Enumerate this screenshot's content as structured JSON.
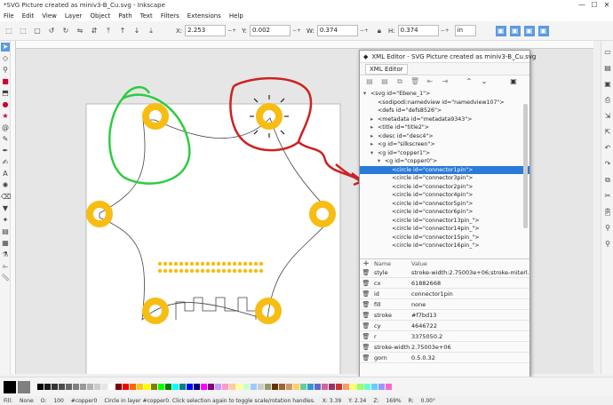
{
  "window": {
    "title": "*SVG Picture created as miniv3-B_Cu.svg - Inkscape",
    "controls": [
      "—",
      "☐",
      "✕"
    ]
  },
  "menu": [
    "File",
    "Edit",
    "View",
    "Layer",
    "Object",
    "Path",
    "Text",
    "Filters",
    "Extensions",
    "Help"
  ],
  "toolbar": {
    "x_label": "X:",
    "x_value": "2.253",
    "y_label": "Y:",
    "y_value": "0.002",
    "w_label": "W:",
    "w_value": "0.374",
    "h_label": "H:",
    "h_value": "0.374",
    "unit": "in"
  },
  "xml_editor": {
    "title": "XML Editor - SVG Picture created as miniv3-B_Cu.svg",
    "tab": "XML Editor",
    "nodes": [
      {
        "indent": 0,
        "arrow": "▾",
        "text": "<svg id=\"Ebene_1\">"
      },
      {
        "indent": 1,
        "arrow": "",
        "text": "<sodipodi:namedview id=\"namedview107\">"
      },
      {
        "indent": 1,
        "arrow": "",
        "text": "<defs id=\"defs8526\">"
      },
      {
        "indent": 1,
        "arrow": "▸",
        "text": "<metadata id=\"metadata9343\">"
      },
      {
        "indent": 1,
        "arrow": "▸",
        "text": "<title id=\"title2\">"
      },
      {
        "indent": 1,
        "arrow": "▸",
        "text": "<desc id=\"desc4\">"
      },
      {
        "indent": 1,
        "arrow": "▸",
        "text": "<g id=\"silkscreen\">"
      },
      {
        "indent": 1,
        "arrow": "▾",
        "text": "<g id=\"copper1\">"
      },
      {
        "indent": 2,
        "arrow": "▾",
        "text": "<g id=\"copper0\">"
      },
      {
        "indent": 3,
        "arrow": "",
        "text": "<circle id=\"connector1pin\">",
        "selected": true
      },
      {
        "indent": 3,
        "arrow": "",
        "text": "<circle id=\"connector3pin\">"
      },
      {
        "indent": 3,
        "arrow": "",
        "text": "<circle id=\"connector2pin\">"
      },
      {
        "indent": 3,
        "arrow": "",
        "text": "<circle id=\"connector4pin\">"
      },
      {
        "indent": 3,
        "arrow": "",
        "text": "<circle id=\"connector5pin\">"
      },
      {
        "indent": 3,
        "arrow": "",
        "text": "<circle id=\"connector6pin\">"
      },
      {
        "indent": 3,
        "arrow": "",
        "text": "<circle id=\"connector13pin_\">"
      },
      {
        "indent": 3,
        "arrow": "",
        "text": "<circle id=\"connector14pin_\">"
      },
      {
        "indent": 3,
        "arrow": "",
        "text": "<circle id=\"connector15pin_\">"
      },
      {
        "indent": 3,
        "arrow": "",
        "text": "<circle id=\"connector16pin_\">"
      }
    ],
    "attr_header": {
      "add": "+",
      "name": "Name",
      "value": "Value"
    },
    "attributes": [
      {
        "name": "style",
        "value": "stroke-width:2.75003e+06;stroke-miterl..."
      },
      {
        "name": "cx",
        "value": "61882668"
      },
      {
        "name": "id",
        "value": "connector1pin"
      },
      {
        "name": "fill",
        "value": "none"
      },
      {
        "name": "stroke",
        "value": "#f7bd13"
      },
      {
        "name": "cy",
        "value": "4646722"
      },
      {
        "name": "r",
        "value": "3375050.2"
      },
      {
        "name": "stroke-width",
        "value": "2.75003e+06"
      },
      {
        "name": "gorn",
        "value": "0.5.0.32"
      }
    ]
  },
  "status": {
    "fill_label": "Fill:",
    "fill_value": "None",
    "stroke_label": "Stroke:",
    "opacity_label": "O:",
    "opacity_value": "100",
    "layer": "#copper0",
    "message": "Circle in layer #copper0. Click selection again to toggle scale/rotation handles.",
    "x_coord": "X: 3.39",
    "y_coord": "Y: 2.34",
    "zoom_label": "Z:",
    "zoom": "169%",
    "rotation_label": "R:",
    "rotation": "0.00°"
  },
  "colors": {
    "pad": "#f7bd13",
    "selected_row": "#2a7ad8",
    "green_annotation": "#2ecc40",
    "red_annotation": "#cc2222"
  },
  "palette": [
    "#000000",
    "#1a1a1a",
    "#333333",
    "#4d4d4d",
    "#666666",
    "#808080",
    "#999999",
    "#b3b3b3",
    "#cccccc",
    "#e6e6e6",
    "#ffffff",
    "#800000",
    "#ff0000",
    "#ff6600",
    "#ffcc00",
    "#ffff00",
    "#808000",
    "#00ff00",
    "#008000",
    "#00ffff",
    "#008080",
    "#0000ff",
    "#000080",
    "#ff00ff",
    "#800080",
    "#cc99ff",
    "#ff99cc",
    "#ffcc99",
    "#ffff99",
    "#ccffcc",
    "#99ccff",
    "#cccccc",
    "#999966",
    "#663300",
    "#996633",
    "#cc9966",
    "#ffcc66",
    "#66cc99",
    "#3399cc",
    "#6666cc",
    "#cc6699",
    "#993366",
    "#cc3333",
    "#ff9966",
    "#ffff66",
    "#99ff66",
    "#66ffcc",
    "#66ccff",
    "#9999ff",
    "#ff66cc"
  ]
}
